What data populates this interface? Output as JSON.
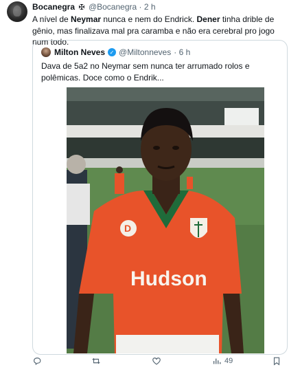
{
  "author": {
    "display_name": "Bocanegra",
    "badge": "✠",
    "handle": "@Bocanegra",
    "time": "· 2 h"
  },
  "tweet": {
    "parts": [
      {
        "text": "A nível de ",
        "bold": false
      },
      {
        "text": "Neymar",
        "bold": true
      },
      {
        "text": " nunca e nem do Endrick. ",
        "bold": false
      },
      {
        "text": "Dener",
        "bold": true
      },
      {
        "text": " tinha drible de gênio, mas finalizava mal pra caramba e não era cerebral pro jogo num todo.",
        "bold": false
      }
    ]
  },
  "quote": {
    "display_name": "Milton Neves",
    "handle": "@Miltonneves",
    "time": "· 6 h",
    "text": "Dava de 5a2 no Neymar sem nunca ter arrumado rolos e polêmicas. Doce como o Endrik...",
    "photo": {
      "jersey_text": "Hudson",
      "sponsor_text": "D",
      "colors": {
        "jersey": "#e8532a",
        "collar": "#1f6b3a",
        "pitch": "#5f8a4f"
      }
    }
  },
  "actions": {
    "reply_count": "",
    "retweet_count": "",
    "like_count": "",
    "views_count": "49"
  },
  "colors": {
    "accent": "#1d9bf0",
    "muted": "#536471",
    "border": "#cfd9de"
  }
}
